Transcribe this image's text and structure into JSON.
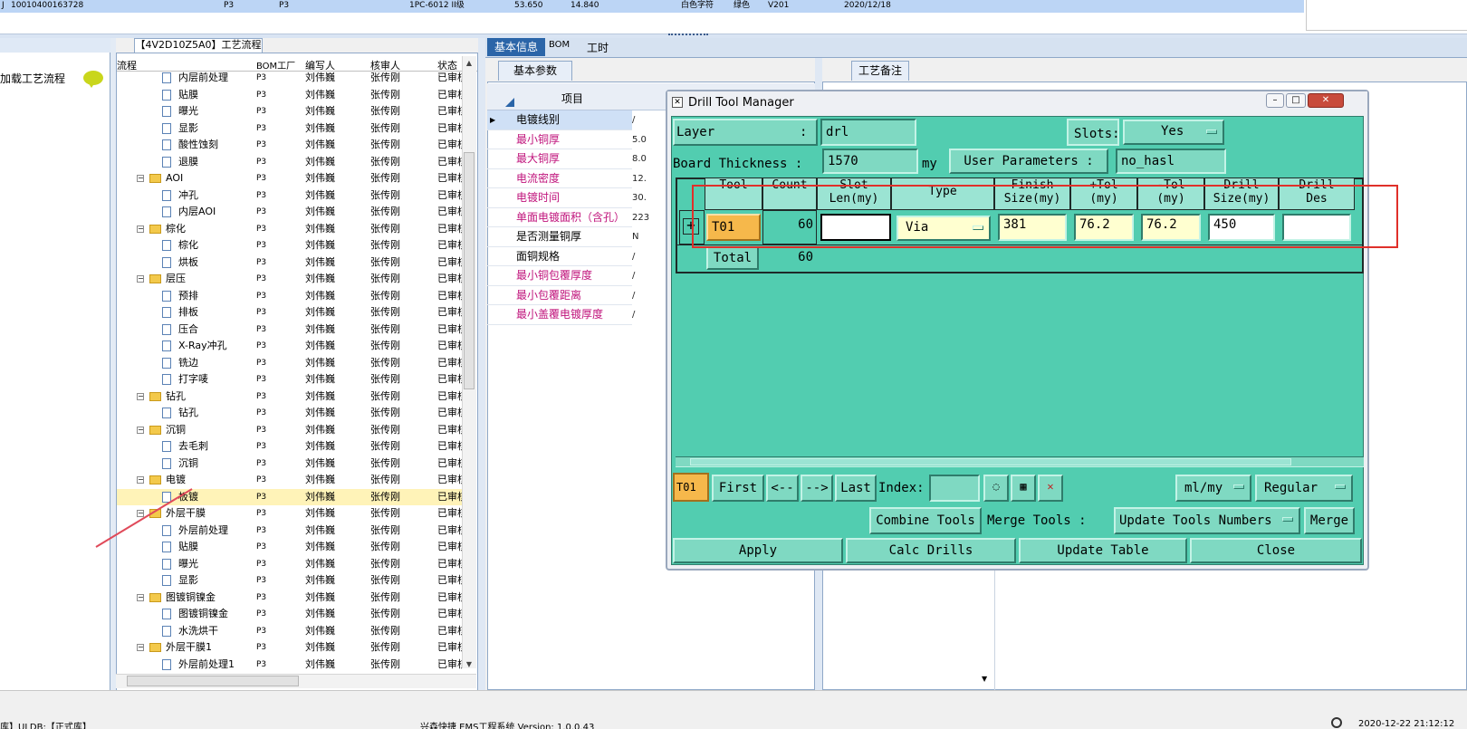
{
  "top_row": {
    "cells": [
      "J",
      "10010400163728",
      "P3",
      "P3",
      "1PC-6012 II级",
      "53.650",
      "14.840",
      "白色字符",
      "绿色",
      "V201",
      "2020/12/18"
    ]
  },
  "left_panel": {
    "load_flow_label": "加载工艺流程"
  },
  "tree": {
    "title": "【4V2D10Z5A0】工艺流程",
    "headers": {
      "flow": "流程",
      "bom_factory": "BOM工厂",
      "writer": "编写人",
      "reviewer": "核审人",
      "status": "状态"
    },
    "rows": [
      {
        "name": "内层前处理",
        "type": "doc",
        "bom": "P3",
        "writer": "刘伟巍",
        "reviewer": "张传刚",
        "status": "已审核"
      },
      {
        "name": "贴膜",
        "type": "doc",
        "bom": "P3",
        "writer": "刘伟巍",
        "reviewer": "张传刚",
        "status": "已审核"
      },
      {
        "name": "曝光",
        "type": "doc",
        "bom": "P3",
        "writer": "刘伟巍",
        "reviewer": "张传刚",
        "status": "已审核"
      },
      {
        "name": "显影",
        "type": "doc",
        "bom": "P3",
        "writer": "刘伟巍",
        "reviewer": "张传刚",
        "status": "已审核"
      },
      {
        "name": "酸性蚀刻",
        "type": "doc",
        "bom": "P3",
        "writer": "刘伟巍",
        "reviewer": "张传刚",
        "status": "已审核"
      },
      {
        "name": "退膜",
        "type": "doc",
        "bom": "P3",
        "writer": "刘伟巍",
        "reviewer": "张传刚",
        "status": "已审核"
      },
      {
        "name": "AOI",
        "type": "folder",
        "bom": "P3",
        "writer": "刘伟巍",
        "reviewer": "张传刚",
        "status": "已审核"
      },
      {
        "name": "冲孔",
        "type": "doc",
        "bom": "P3",
        "writer": "刘伟巍",
        "reviewer": "张传刚",
        "status": "已审核"
      },
      {
        "name": "内层AOI",
        "type": "doc",
        "bom": "P3",
        "writer": "刘伟巍",
        "reviewer": "张传刚",
        "status": "已审核"
      },
      {
        "name": "棕化",
        "type": "folder",
        "bom": "P3",
        "writer": "刘伟巍",
        "reviewer": "张传刚",
        "status": "已审核"
      },
      {
        "name": "棕化",
        "type": "doc",
        "bom": "P3",
        "writer": "刘伟巍",
        "reviewer": "张传刚",
        "status": "已审核"
      },
      {
        "name": "烘板",
        "type": "doc",
        "bom": "P3",
        "writer": "刘伟巍",
        "reviewer": "张传刚",
        "status": "已审核"
      },
      {
        "name": "层压",
        "type": "folder",
        "bom": "P3",
        "writer": "刘伟巍",
        "reviewer": "张传刚",
        "status": "已审核"
      },
      {
        "name": "预排",
        "type": "doc",
        "bom": "P3",
        "writer": "刘伟巍",
        "reviewer": "张传刚",
        "status": "已审核"
      },
      {
        "name": "排板",
        "type": "doc",
        "bom": "P3",
        "writer": "刘伟巍",
        "reviewer": "张传刚",
        "status": "已审核"
      },
      {
        "name": "压合",
        "type": "doc",
        "bom": "P3",
        "writer": "刘伟巍",
        "reviewer": "张传刚",
        "status": "已审核"
      },
      {
        "name": "X-Ray冲孔",
        "type": "doc",
        "bom": "P3",
        "writer": "刘伟巍",
        "reviewer": "张传刚",
        "status": "已审核"
      },
      {
        "name": "铣边",
        "type": "doc",
        "bom": "P3",
        "writer": "刘伟巍",
        "reviewer": "张传刚",
        "status": "已审核"
      },
      {
        "name": "打字唛",
        "type": "doc",
        "bom": "P3",
        "writer": "刘伟巍",
        "reviewer": "张传刚",
        "status": "已审核"
      },
      {
        "name": "钻孔",
        "type": "folder",
        "bom": "P3",
        "writer": "刘伟巍",
        "reviewer": "张传刚",
        "status": "已审核"
      },
      {
        "name": "钻孔",
        "type": "doc",
        "bom": "P3",
        "writer": "刘伟巍",
        "reviewer": "张传刚",
        "status": "已审核"
      },
      {
        "name": "沉铜",
        "type": "folder",
        "bom": "P3",
        "writer": "刘伟巍",
        "reviewer": "张传刚",
        "status": "已审核"
      },
      {
        "name": "去毛刺",
        "type": "doc",
        "bom": "P3",
        "writer": "刘伟巍",
        "reviewer": "张传刚",
        "status": "已审核"
      },
      {
        "name": "沉铜",
        "type": "doc",
        "bom": "P3",
        "writer": "刘伟巍",
        "reviewer": "张传刚",
        "status": "已审核"
      },
      {
        "name": "电镀",
        "type": "folder",
        "bom": "P3",
        "writer": "刘伟巍",
        "reviewer": "张传刚",
        "status": "已审核"
      },
      {
        "name": "板镀",
        "type": "doc",
        "bom": "P3",
        "writer": "刘伟巍",
        "reviewer": "张传刚",
        "status": "已审核",
        "selected": true
      },
      {
        "name": "外层干膜",
        "type": "folder",
        "bom": "P3",
        "writer": "刘伟巍",
        "reviewer": "张传刚",
        "status": "已审核"
      },
      {
        "name": "外层前处理",
        "type": "doc",
        "bom": "P3",
        "writer": "刘伟巍",
        "reviewer": "张传刚",
        "status": "已审核"
      },
      {
        "name": "贴膜",
        "type": "doc",
        "bom": "P3",
        "writer": "刘伟巍",
        "reviewer": "张传刚",
        "status": "已审核"
      },
      {
        "name": "曝光",
        "type": "doc",
        "bom": "P3",
        "writer": "刘伟巍",
        "reviewer": "张传刚",
        "status": "已审核"
      },
      {
        "name": "显影",
        "type": "doc",
        "bom": "P3",
        "writer": "刘伟巍",
        "reviewer": "张传刚",
        "status": "已审核"
      },
      {
        "name": "图镀铜镍金",
        "type": "folder",
        "bom": "P3",
        "writer": "刘伟巍",
        "reviewer": "张传刚",
        "status": "已审核"
      },
      {
        "name": "图镀铜镍金",
        "type": "doc",
        "bom": "P3",
        "writer": "刘伟巍",
        "reviewer": "张传刚",
        "status": "已审核"
      },
      {
        "name": "水洗烘干",
        "type": "doc",
        "bom": "P3",
        "writer": "刘伟巍",
        "reviewer": "张传刚",
        "status": "已审核"
      },
      {
        "name": "外层干膜1",
        "type": "folder",
        "bom": "P3",
        "writer": "刘伟巍",
        "reviewer": "张传刚",
        "status": "已审核"
      },
      {
        "name": "外层前处理1",
        "type": "doc",
        "bom": "P3",
        "writer": "刘伟巍",
        "reviewer": "张传刚",
        "status": "已审核"
      }
    ]
  },
  "info_panel": {
    "tabs": [
      "基本信息",
      "BOM",
      "工时"
    ],
    "subtab_params": "基本参数",
    "subtab_notes": "工艺备注",
    "param_header": "项目",
    "params": [
      {
        "name": "电镀线别",
        "value": "/",
        "color": "#000000"
      },
      {
        "name": "最小铜厚",
        "value": "5.0",
        "color": "#c0147c"
      },
      {
        "name": "最大铜厚",
        "value": "8.0",
        "color": "#c0147c"
      },
      {
        "name": "电流密度",
        "value": "12.",
        "color": "#c0147c"
      },
      {
        "name": "电镀时间",
        "value": "30.",
        "color": "#c0147c"
      },
      {
        "name": "单面电镀面积（含孔）",
        "value": "223",
        "color": "#c0147c"
      },
      {
        "name": "是否测量铜厚",
        "value": "N",
        "color": "#000000"
      },
      {
        "name": "面铜规格",
        "value": "/",
        "color": "#000000"
      },
      {
        "name": "最小铜包覆厚度",
        "value": "/",
        "color": "#c0147c"
      },
      {
        "name": "最小包覆距离",
        "value": "/",
        "color": "#c0147c"
      },
      {
        "name": "最小盖覆电镀厚度",
        "value": "/",
        "color": "#c0147c"
      }
    ]
  },
  "dialog": {
    "title": "Drill Tool Manager",
    "layer_label": "Layer",
    "layer_colon": ":",
    "layer_value": "drl",
    "slots_label": "Slots:",
    "slots_value": "Yes",
    "board_thickness_label": "Board Thickness :",
    "board_thickness_value": "1570",
    "board_thickness_unit": "my",
    "user_params_button": "User Parameters :",
    "user_params_value": "no_hasl",
    "grid_headers": {
      "tool": "Tool",
      "count": "Count",
      "slot_len": "Slot\nLen(my)",
      "type": "Type",
      "finish_size": "Finish\nSize(my)",
      "plus_tol": "+Tol\n(my)",
      "minus_tol": "-Tol\n(my)",
      "drill_size": "Drill\nSize(my)",
      "drill_des": "Drill\nDes"
    },
    "row": {
      "expander": "+",
      "tool": "T01",
      "count": "60",
      "slot_len": "",
      "type": "Via",
      "finish_size": "381",
      "plus_tol": "76.2",
      "minus_tol": "76.2",
      "drill_size": "450",
      "drill_des": ""
    },
    "total_label": "Total",
    "total_count": "60",
    "nav": {
      "current_tool": "T01",
      "first": "First",
      "prev": "<--",
      "next": "-->",
      "last": "Last",
      "index_label": "Index:",
      "units": "ml/my",
      "mode": "Regular"
    },
    "actions": {
      "combine_tools": "Combine Tools",
      "merge_tools_label": "Merge Tools :",
      "update_tools_numbers": "Update Tools Numbers",
      "merge": "Merge",
      "apply": "Apply",
      "calc_drills": "Calc Drills",
      "update_table": "Update Table",
      "close": "Close"
    }
  },
  "status_bar": {
    "left": "库】ULDB:【正式库】",
    "center": "兴森快捷 EMS工程系统 Version: 1.0.0.43",
    "time": "2020-12-22 21:12:12"
  }
}
